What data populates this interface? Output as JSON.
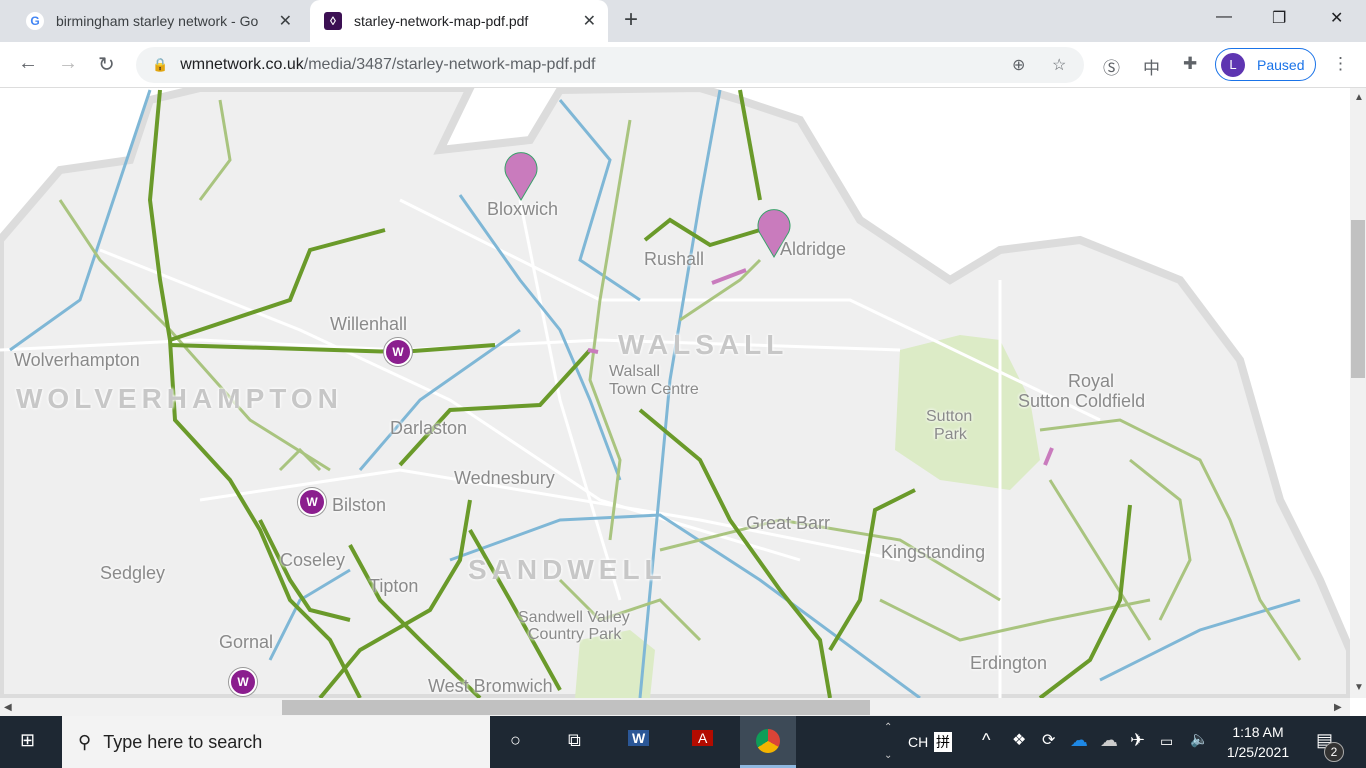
{
  "browser": {
    "tabs": [
      {
        "title": "birmingham starley network - Go",
        "icon": "google-icon"
      },
      {
        "title": "starley-network-map-pdf.pdf",
        "icon": "wmnetwork-icon"
      }
    ],
    "url_host": "wmnetwork.co.uk",
    "url_path": "/media/3487/starley-network-map-pdf.pdf",
    "profile_initial": "L",
    "profile_status": "Paused"
  },
  "map": {
    "labels": [
      "Bloxwich",
      "Rushall",
      "Aldridge",
      "WALSALL",
      "Willenhall",
      "Wolverhampton",
      "WOLVERHAMPTON",
      "Walsall",
      "Town Centre",
      "Darlaston",
      "Wednesbury",
      "Bilston",
      "Sutton",
      "Park",
      "Royal",
      "Sutton Coldfield",
      "Great Barr",
      "Kingstanding",
      "Sedgley",
      "Coseley",
      "Tipton",
      "SANDWELL",
      "Sandwell Valley",
      "Country Park",
      "Gornal",
      "West Bromwich",
      "Erdington"
    ],
    "marker_label": "W",
    "colors": {
      "route": "#6a9a2a",
      "route_light": "#a9c47f",
      "canal": "#7fb7d6",
      "park": "#dcebc6",
      "boundary": "#dcdcdc",
      "marker": "#8b1e8e",
      "pin": "#c97bbd"
    }
  },
  "taskbar": {
    "search_placeholder": "Type here to search",
    "lang": "CH",
    "ime": "拼",
    "time": "1:18 AM",
    "date": "1/25/2021",
    "notifications": "2"
  }
}
